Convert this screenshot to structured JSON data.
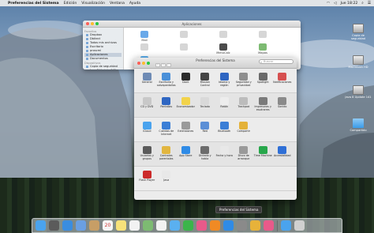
{
  "menubar": {
    "app": "Preferencias del Sistema",
    "menus": [
      "Edición",
      "Visualización",
      "Ventana",
      "Ayuda"
    ],
    "clock": "Jue 18:22"
  },
  "desktop": [
    {
      "label": "Copia de seguridad",
      "kind": "hdd"
    },
    {
      "label": "Macintosh HD",
      "kind": "hdd"
    },
    {
      "label": "Java 8 Update 141",
      "kind": "hdd"
    },
    {
      "label": "Compartido",
      "kind": "folder"
    }
  ],
  "finder": {
    "title": "Aplicaciones",
    "sidebar": [
      {
        "header": "Favoritos"
      },
      {
        "label": "Dropbox"
      },
      {
        "label": "Dbitect"
      },
      {
        "label": "Todos mis archivos"
      },
      {
        "label": "Escritorio"
      },
      {
        "label": "proscmi"
      },
      {
        "label": "Aplicaciones",
        "selected": true
      },
      {
        "label": "Documentos"
      },
      {
        "header": "Dispositivos"
      },
      {
        "label": "Copia de seguridad"
      },
      {
        "label": "Java 8 Update 141"
      },
      {
        "header": "Compartido"
      },
      {
        "label": "hp0035fa1148"
      },
      {
        "label": "antbsmar"
      },
      {
        "label": "emiconferciadi08"
      },
      {
        "label": "antliles"
      },
      {
        "label": "antbsedel"
      },
      {
        "label": "antmiguel"
      },
      {
        "label": "Todos..."
      }
    ],
    "apps": [
      {
        "label": "Mail",
        "color": "#6aa9e9"
      },
      {
        "label": "",
        "color": "#d6d6d6"
      },
      {
        "label": "",
        "color": "#d6d6d6"
      },
      {
        "label": "",
        "color": "#d6d6d6"
      },
      {
        "label": "",
        "color": "#d6d6d6"
      },
      {
        "label": "",
        "color": "#d6d6d6"
      },
      {
        "label": "MenuCalc",
        "color": "#4b4b4b"
      },
      {
        "label": "Mapas",
        "color": "#7dbb72"
      },
      {
        "label": "Mensajes",
        "color": "#5ab0f0"
      }
    ]
  },
  "prefs": {
    "title": "Preferencias del Sistema",
    "search_placeholder": "Buscar",
    "sections": [
      [
        {
          "label": "General",
          "color": "#6e8bb5"
        },
        {
          "label": "Escritorio y salvapantallas",
          "color": "#4a90d9"
        },
        {
          "label": "Dock",
          "color": "#2d2d2d"
        },
        {
          "label": "Mission Control",
          "color": "#444444"
        },
        {
          "label": "Idioma y región",
          "color": "#2f66c2"
        },
        {
          "label": "Seguridad y privacidad",
          "color": "#8e8e8e"
        },
        {
          "label": "Spotlight",
          "color": "#6a6a6a"
        },
        {
          "label": "Notificaciones",
          "color": "#d65050"
        }
      ],
      [
        {
          "label": "CD y DVD",
          "color": "#c8c8c8"
        },
        {
          "label": "Pantallas",
          "color": "#2f66c2"
        },
        {
          "label": "Economizador",
          "color": "#f2d34a"
        },
        {
          "label": "Teclado",
          "color": "#d9d9d9"
        },
        {
          "label": "Ratón",
          "color": "#ededed"
        },
        {
          "label": "Trackpad",
          "color": "#bcbcbc"
        },
        {
          "label": "Impresoras y escáneres",
          "color": "#7a7a7a"
        },
        {
          "label": "Sonido",
          "color": "#8a8a8a"
        }
      ],
      [
        {
          "label": "iCloud",
          "color": "#4aa3ee"
        },
        {
          "label": "Cuentas de Internet",
          "color": "#3b7ed6"
        },
        {
          "label": "Extensiones",
          "color": "#9a9a9a"
        },
        {
          "label": "Red",
          "color": "#5c8fd6"
        },
        {
          "label": "Bluetooth",
          "color": "#3b7ed6"
        },
        {
          "label": "Compartir",
          "color": "#e4b23a"
        }
      ],
      [
        {
          "label": "Usuarios y grupos",
          "color": "#5a5a5a"
        },
        {
          "label": "Controles parentales",
          "color": "#e2b640"
        },
        {
          "label": "App Store",
          "color": "#2f8be6"
        },
        {
          "label": "Dictado y habla",
          "color": "#6c6c6c"
        },
        {
          "label": "Fecha y hora",
          "color": "#e8e8e8"
        },
        {
          "label": "Disco de arranque",
          "color": "#9a9a9a"
        },
        {
          "label": "Time Machine",
          "color": "#27a74b"
        },
        {
          "label": "Accesibilidad",
          "color": "#2f6fd6"
        }
      ],
      [
        {
          "label": "Flash Player",
          "color": "#cc2a2a"
        },
        {
          "label": "Java",
          "color": "#e8e8e8"
        }
      ]
    ]
  },
  "dock": {
    "tooltip": "Preferencias del Sistema",
    "items": [
      {
        "name": "finder",
        "color": "#4aa3ee"
      },
      {
        "name": "launchpad",
        "color": "#5b5b5b"
      },
      {
        "name": "safari",
        "color": "#3a8de0"
      },
      {
        "name": "mail",
        "color": "#6a9fe2"
      },
      {
        "name": "contacts",
        "color": "#c79e66"
      },
      {
        "name": "calendar",
        "color": "#f5f5f5",
        "text": "20"
      },
      {
        "name": "notes",
        "color": "#f7e27a"
      },
      {
        "name": "reminders",
        "color": "#f2f2f2"
      },
      {
        "name": "maps",
        "color": "#7dbb72"
      },
      {
        "name": "photos",
        "color": "#f2f2f2"
      },
      {
        "name": "messages",
        "color": "#5ab0f0"
      },
      {
        "name": "facetime",
        "color": "#3bb54a"
      },
      {
        "name": "itunes",
        "color": "#e85a8a"
      },
      {
        "name": "ibooks",
        "color": "#f08a24"
      },
      {
        "name": "app-store",
        "color": "#2f8be6"
      },
      {
        "name": "system-preferences",
        "color": "#8a8a8a"
      },
      {
        "name": "chrome",
        "color": "#e7b23a"
      },
      {
        "name": "itunes-2",
        "color": "#e85a8a"
      },
      {
        "name": "downloads",
        "color": "#4aa3ee"
      },
      {
        "name": "trash",
        "color": "#d0d0d0"
      }
    ]
  }
}
